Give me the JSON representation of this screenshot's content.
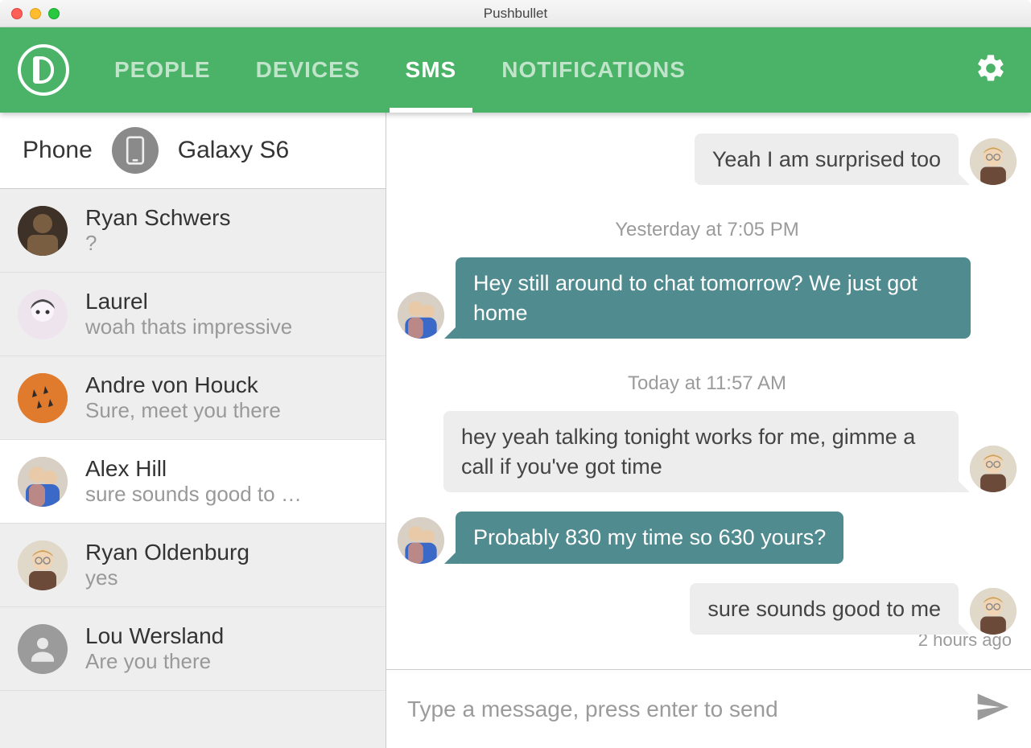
{
  "window": {
    "title": "Pushbullet"
  },
  "header": {
    "tabs": [
      "PEOPLE",
      "DEVICES",
      "SMS",
      "NOTIFICATIONS"
    ],
    "active_index": 2
  },
  "sidebar": {
    "phone_label": "Phone",
    "device_name": "Galaxy S6",
    "conversations": [
      {
        "name": "Ryan Schwers",
        "preview": "?",
        "selected": false,
        "avatar_bg": "#5b4a3a"
      },
      {
        "name": "Laurel",
        "preview": "woah thats impressive",
        "selected": false,
        "avatar_bg": "#e9dfe9"
      },
      {
        "name": "Andre von Houck",
        "preview": "Sure, meet you there",
        "selected": false,
        "avatar_bg": "#e07a2d"
      },
      {
        "name": "Alex Hill",
        "preview": "sure sounds good to …",
        "selected": true,
        "avatar_bg": "#cbb9a6"
      },
      {
        "name": "Ryan Oldenburg",
        "preview": "yes",
        "selected": false,
        "avatar_bg": "#d9c7a8"
      },
      {
        "name": "Lou Wersland",
        "preview": "Are you there",
        "selected": false,
        "avatar_bg": "#9b9b9b"
      }
    ]
  },
  "chat": {
    "messages": [
      {
        "kind": "out",
        "text": "Yeah I am surprised too"
      },
      {
        "kind": "divider",
        "text": "Yesterday at 7:05 PM"
      },
      {
        "kind": "in",
        "text": "Hey still around to chat tomorrow? We just got home"
      },
      {
        "kind": "divider",
        "text": "Today at 11:57 AM"
      },
      {
        "kind": "out",
        "text": "hey yeah talking tonight works for me, gimme a call if you've got time"
      },
      {
        "kind": "in",
        "text": "Probably 830 my time so 630 yours?"
      },
      {
        "kind": "out",
        "text": "sure sounds good to me"
      }
    ],
    "last_meta": "2 hours ago",
    "compose_placeholder": "Type a message, press enter to send"
  },
  "colors": {
    "accent": "#4ab367",
    "bubble_in": "#4f8b8f",
    "bubble_out": "#ededed"
  }
}
